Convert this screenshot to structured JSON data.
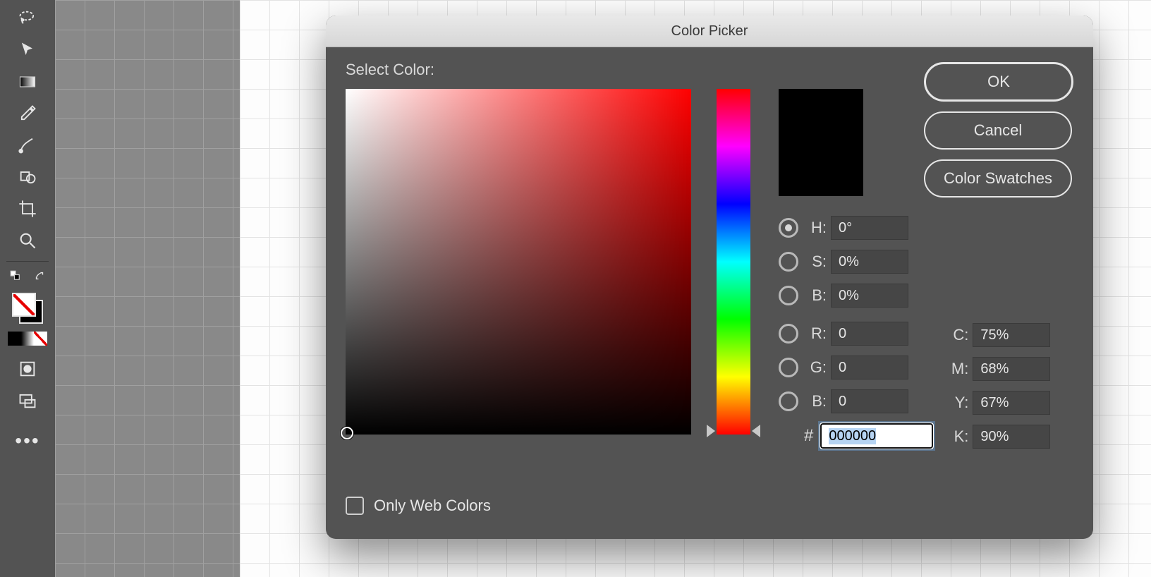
{
  "dialog": {
    "title": "Color Picker",
    "select_label": "Select Color:",
    "buttons": {
      "ok": "OK",
      "cancel": "Cancel",
      "swatches": "Color Swatches"
    },
    "web_colors_label": "Only Web Colors",
    "preview_color": "#000000",
    "hue_selected_hex": "#ff0000",
    "fields": {
      "h": {
        "label": "H:",
        "value": "0°"
      },
      "s": {
        "label": "S:",
        "value": "0%"
      },
      "b": {
        "label": "B:",
        "value": "0%"
      },
      "r": {
        "label": "R:",
        "value": "0"
      },
      "g": {
        "label": "G:",
        "value": "0"
      },
      "bb": {
        "label": "B:",
        "value": "0"
      },
      "hex": {
        "label": "#",
        "value": "000000"
      },
      "c": {
        "label": "C:",
        "value": "75%"
      },
      "m": {
        "label": "M:",
        "value": "68%"
      },
      "y": {
        "label": "Y:",
        "value": "67%"
      },
      "k": {
        "label": "K:",
        "value": "90%"
      }
    },
    "selected_radio": "h"
  },
  "tools": {
    "items": [
      "lasso-tool",
      "cursor-tool",
      "gradient-tool",
      "eyedropper-tool",
      "brush-tool",
      "shape-tool",
      "crop-tool",
      "zoom-tool"
    ],
    "more": "•••"
  }
}
